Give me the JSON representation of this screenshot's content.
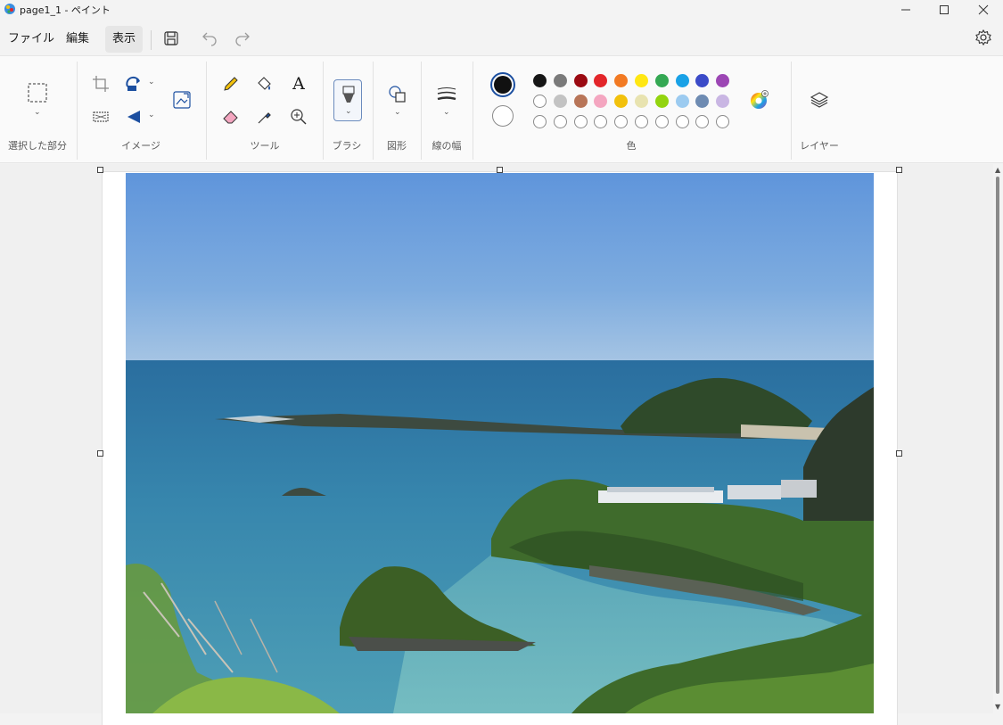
{
  "window": {
    "title": "page1_1 - ペイント",
    "minimize_icon": "minimize-icon",
    "maximize_icon": "maximize-icon",
    "close_icon": "close-icon"
  },
  "menu": {
    "file": "ファイル",
    "edit": "編集",
    "view": "表示",
    "save_icon": "save-icon",
    "undo_icon": "undo-icon",
    "redo_icon": "redo-icon",
    "settings_icon": "settings-icon"
  },
  "ribbon": {
    "groups": {
      "selection": "選択した部分",
      "image": "イメージ",
      "tools": "ツール",
      "brush": "ブラシ",
      "shapes": "図形",
      "line_width": "線の幅",
      "colors": "色",
      "layers": "レイヤー"
    },
    "selected_colors": {
      "primary": "#111111",
      "secondary": "#ffffff"
    },
    "palette": [
      [
        "#161616",
        "#7a7a7a",
        "#9b0a12",
        "#e3262a",
        "#f27a23",
        "#ffe713",
        "#34a853",
        "#19a1e6",
        "#3b4bc8",
        "#9c46b4"
      ],
      [
        "#ffffff",
        "#c3c3c3",
        "#b87558",
        "#f4a6c0",
        "#f2c10c",
        "#e8e3b0",
        "#93d40f",
        "#9ccbf0",
        "#6e8bb2",
        "#c9b6e3"
      ],
      [
        "",
        "",
        "",
        "",
        "",
        "",
        "",
        "",
        "",
        ""
      ]
    ]
  },
  "canvas": {
    "image_description": "coastal landscape photo"
  }
}
